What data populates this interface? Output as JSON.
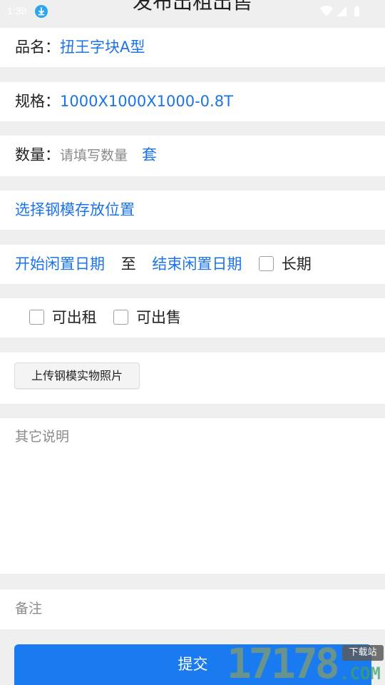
{
  "status_bar": {
    "time": "1:38"
  },
  "page_title": "发布出租出售",
  "product": {
    "label": "品名：",
    "value": "扭王字块A型"
  },
  "spec": {
    "label": "规格：",
    "value": "1000X1000X1000-0.8T"
  },
  "quantity": {
    "label": "数量：",
    "placeholder": "请填写数量",
    "unit": "套"
  },
  "location": {
    "link": "选择钢模存放位置"
  },
  "idle_period": {
    "start": "开始闲置日期",
    "to": "至",
    "end": "结束闲置日期",
    "long_term": "长期"
  },
  "options": {
    "rent": "可出租",
    "sell": "可出售"
  },
  "upload": {
    "label": "上传钢模实物照片"
  },
  "description": {
    "placeholder": "其它说明"
  },
  "remark": {
    "placeholder": "备注"
  },
  "submit": {
    "label": "提交"
  },
  "watermark": {
    "digits": "17178",
    "com": ".COM",
    "tag": "下载站"
  },
  "colors": {
    "accent": "#1a73e8",
    "submit": "#1a7bf0",
    "background": "#efefef"
  }
}
